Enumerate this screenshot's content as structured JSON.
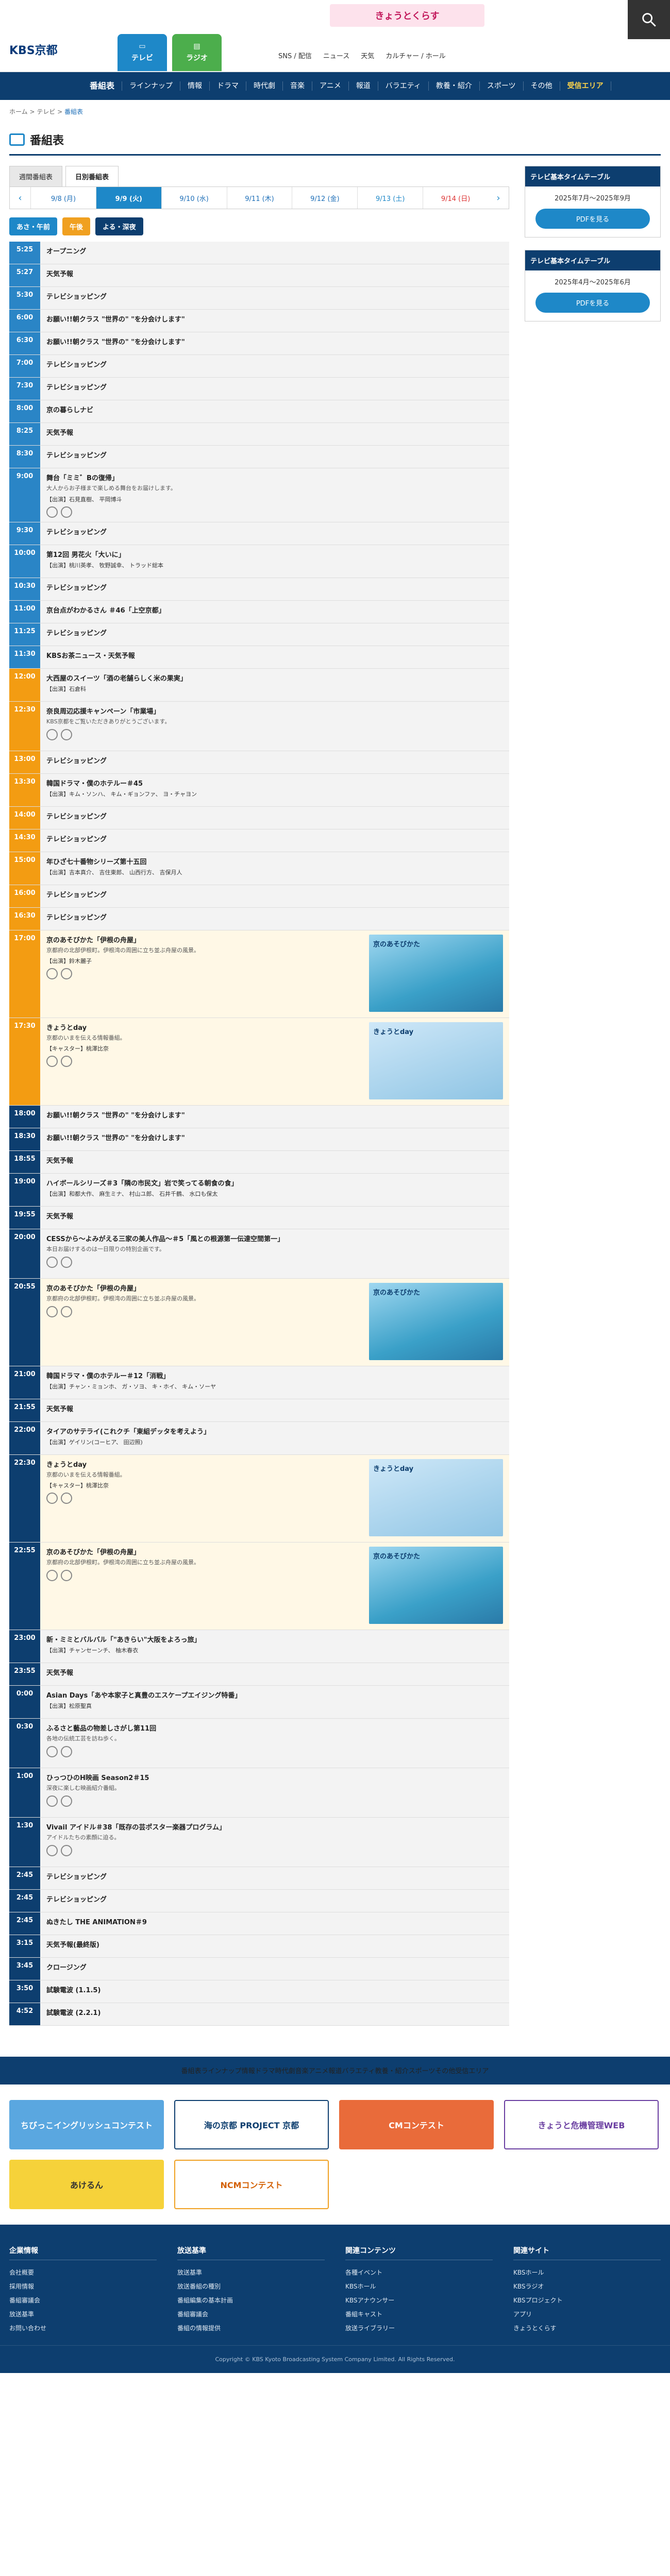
{
  "header": {
    "logo": "KBS京都",
    "campaign": "きょうとくらす",
    "tabs": [
      "テレビ",
      "ラジオ"
    ],
    "links": [
      "SNS / 配信",
      "ニュース",
      "天気",
      "カルチャー / ホール"
    ]
  },
  "nav": [
    "番組表",
    "ラインナップ",
    "情報",
    "ドラマ",
    "時代劇",
    "音楽",
    "アニメ",
    "報道",
    "バラエティ",
    "教養・紹介",
    "スポーツ",
    "その他",
    "受信エリア"
  ],
  "breadcrumb": {
    "home": "ホーム",
    "tv": "テレビ",
    "cur": "番組表"
  },
  "page_title": "番組表",
  "view_tabs": [
    "週間番組表",
    "日別番組表"
  ],
  "dates": [
    "9/8 (月)",
    "9/9 (火)",
    "9/10 (水)",
    "9/11 (木)",
    "9/12 (金)",
    "9/13 (土)",
    "9/14 (日)"
  ],
  "filters": [
    "あさ・午前",
    "午後",
    "よる・深夜"
  ],
  "programs": [
    {
      "time": "5:25",
      "title": "オープニング"
    },
    {
      "time": "5:27",
      "title": "天気予報"
    },
    {
      "time": "5:30",
      "title": "テレビショッピング"
    },
    {
      "time": "6:00",
      "title": "お願い!!朝クラス \"世界の\" \"を分会けします\""
    },
    {
      "time": "6:30",
      "title": "お願い!!朝クラス \"世界の\" \"を分会けします\""
    },
    {
      "time": "7:00",
      "title": "テレビショッピング"
    },
    {
      "time": "7:30",
      "title": "テレビショッピング"
    },
    {
      "time": "8:00",
      "title": "京の暮らしナビ"
    },
    {
      "time": "8:25",
      "title": "天気予報"
    },
    {
      "time": "8:30",
      "title": "テレビショッピング"
    },
    {
      "time": "9:00",
      "title": "舞台「ミミ゛Bの復帰」",
      "desc": "大人からお子様まで楽しめる舞台をお届けします。",
      "cast": "【出演】石見直樹、 平岡博斗"
    },
    {
      "time": "9:30",
      "title": "テレビショッピング"
    },
    {
      "time": "10:00",
      "title": "第12回 男花火「大いに」",
      "cast": "【出演】桃川英孝、 牧野誠幸、 トラッド総本"
    },
    {
      "time": "10:30",
      "title": "テレビショッピング"
    },
    {
      "time": "11:00",
      "title": "京台点がわかるさん ＃46「上空京都」"
    },
    {
      "time": "11:25",
      "title": "テレビショッピング"
    },
    {
      "time": "11:30",
      "title": "KBSお茶ニュース・天気予報"
    },
    {
      "time": "12:00",
      "title": "大西屋のスイーツ「酒の老舗らしく米の果実」",
      "cast": "【出演】石倉科"
    },
    {
      "time": "12:30",
      "title": "奈良周辺応援キャンペーン「市業場」",
      "desc": "KBS京都をご覧いただきありがとうございます。"
    },
    {
      "time": "13:00",
      "title": "テレビショッピング"
    },
    {
      "time": "13:30",
      "title": "韓国ドラマ・僕のホテルー＃45",
      "cast": "【出演】キム・ソンハ、 キム・ギョンファ、 ヨ・チャヨン"
    },
    {
      "time": "14:00",
      "title": "テレビショッピング"
    },
    {
      "time": "14:30",
      "title": "テレビショッピング"
    },
    {
      "time": "15:00",
      "title": "年ひざ七十番物シリーズ第十五回",
      "cast": "【出演】吉本真介、 吉住東郎、 山西行方、 吉保月人"
    },
    {
      "time": "16:00",
      "title": "テレビショッピング"
    },
    {
      "time": "16:30",
      "title": "テレビショッピング"
    },
    {
      "time": "17:00",
      "title": "京のあそびかた「伊根の舟屋」",
      "desc": "京都府の北部伊根町。伊根湾の周囲に立ち並ぶ舟屋の風景。",
      "cast": "【出演】鈴木麗子",
      "thumb": "京のあそびかた"
    },
    {
      "time": "17:30",
      "title": "きょうとday",
      "desc": "京都のいまを伝える情報番組。",
      "cast": "【キャスター】桃澤比奈",
      "thumb": "きょうとday",
      "people": true
    },
    {
      "time": "18:00",
      "title": "お願い!!朝クラス \"世界の\" \"を分会けします\""
    },
    {
      "time": "18:30",
      "title": "お願い!!朝クラス \"世界の\" \"を分会けします\""
    },
    {
      "time": "18:55",
      "title": "天気予報"
    },
    {
      "time": "19:00",
      "title": "ハイボールシリーズ＃3「隣の市民文」岩で笑ってる朝食の食」",
      "cast": "【出演】和都大作、 麻生ミナ、 村山ユ郎、 石井千鶴、 水口も保太"
    },
    {
      "time": "19:55",
      "title": "天気予報"
    },
    {
      "time": "20:00",
      "title": "CESSから～よみがえる三家の美人作品～＃5「風との根源第一伝達空間第一」",
      "desc": "本日お届けするのは一日限りの特別企画です。"
    },
    {
      "time": "20:55",
      "title": "京のあそびかた「伊根の舟屋」",
      "desc": "京都府の北部伊根町。伊根湾の周囲に立ち並ぶ舟屋の風景。",
      "thumb": "京のあそびかた"
    },
    {
      "time": "21:00",
      "title": "韓国ドラマ・僕のホテルー＃12「消戦」",
      "cast": "【出演】チャン・ミョンホ、 ガ・ソヨ、 キ・ホイ、 キム・ソーヤ"
    },
    {
      "time": "21:55",
      "title": "天気予報"
    },
    {
      "time": "22:00",
      "title": "タイアのサテライ(これクチ「東組デッタを考えよう」",
      "cast": "【出演】ゲイリン(コーヒア、 田辺照)"
    },
    {
      "time": "22:30",
      "title": "きょうとday",
      "desc": "京都のいまを伝える情報番組。",
      "cast": "【キャスター】桃澤比奈",
      "thumb": "きょうとday",
      "people": true
    },
    {
      "time": "22:55",
      "title": "京のあそびかた「伊根の舟屋」",
      "desc": "京都府の北部伊根町。伊根湾の周囲に立ち並ぶ舟屋の風景。",
      "thumb": "京のあそびかた"
    },
    {
      "time": "23:00",
      "title": "新・ミミとバルバル「\"あきらい\"大阪をよろっ旅」",
      "cast": "【出演】チャンセーンチ、 柚木春衣"
    },
    {
      "time": "23:55",
      "title": "天気予報"
    },
    {
      "time": "0:00",
      "title": "Asian Days「あや本家子と真豊のエスケープエイジング特番」",
      "cast": "【出演】松原聖真"
    },
    {
      "time": "0:30",
      "title": "ふるさと藝品の物差しさがし第11回",
      "desc": "各地の伝統工芸を訪ね歩く。"
    },
    {
      "time": "1:00",
      "title": "ひっつひのH映画 Season2＃15",
      "desc": "深夜に楽しむ映画紹介番組。"
    },
    {
      "time": "1:30",
      "title": "Vivail アイドル＃38「既存の芸ポスター楽器プログラム」",
      "desc": "アイドルたちの素顔に迫る。"
    },
    {
      "time": "2:45",
      "title": "テレビショッピング"
    },
    {
      "time": "2:45",
      "title": "テレビショッピング"
    },
    {
      "time": "2:45",
      "title": "ぬきたし THE ANIMATION＃9"
    },
    {
      "time": "3:15",
      "title": "天気予報(最終版)"
    },
    {
      "time": "3:45",
      "title": "クロージング"
    },
    {
      "time": "3:50",
      "title": "試験電波 (1.1.5)"
    },
    {
      "time": "4:52",
      "title": "試験電波 (2.2.1)"
    }
  ],
  "side": [
    {
      "head": "テレビ基本タイムテーブル",
      "sub": "2025年7月～2025年9月",
      "btn": "PDFを見る"
    },
    {
      "head": "テレビ基本タイムテーブル",
      "sub": "2025年4月～2025年6月",
      "btn": "PDFを見る"
    }
  ],
  "banners": [
    "ちびっこイングリッシュコンテスト",
    "海の京都 PROJECT 京都",
    "CMコンテスト",
    "きょうと危機管理WEB",
    "あけるん",
    "NCMコンテスト"
  ],
  "footer": [
    {
      "head": "企業情報",
      "items": [
        "会社概要",
        "採用情報",
        "番組審議会",
        "放送基準",
        "お問い合わせ"
      ]
    },
    {
      "head": "放送基準",
      "items": [
        "放送基準",
        "放送番組の種別",
        "番組編集の基本計画",
        "番組審議会",
        "番組の情報提供"
      ]
    },
    {
      "head": "関連コンテンツ",
      "items": [
        "各種イベント",
        "KBSホール",
        "KBSアナウンサー",
        "番組キャスト",
        "放送ライブラリー"
      ]
    },
    {
      "head": "関連サイト",
      "items": [
        "KBSホール",
        "KBSラジオ",
        "KBSプロジェクト",
        "アプリ",
        "きょうとくらす"
      ]
    }
  ],
  "copyright": "Copyright © KBS Kyoto Broadcasting System Company Limited. All Rights Reserved."
}
